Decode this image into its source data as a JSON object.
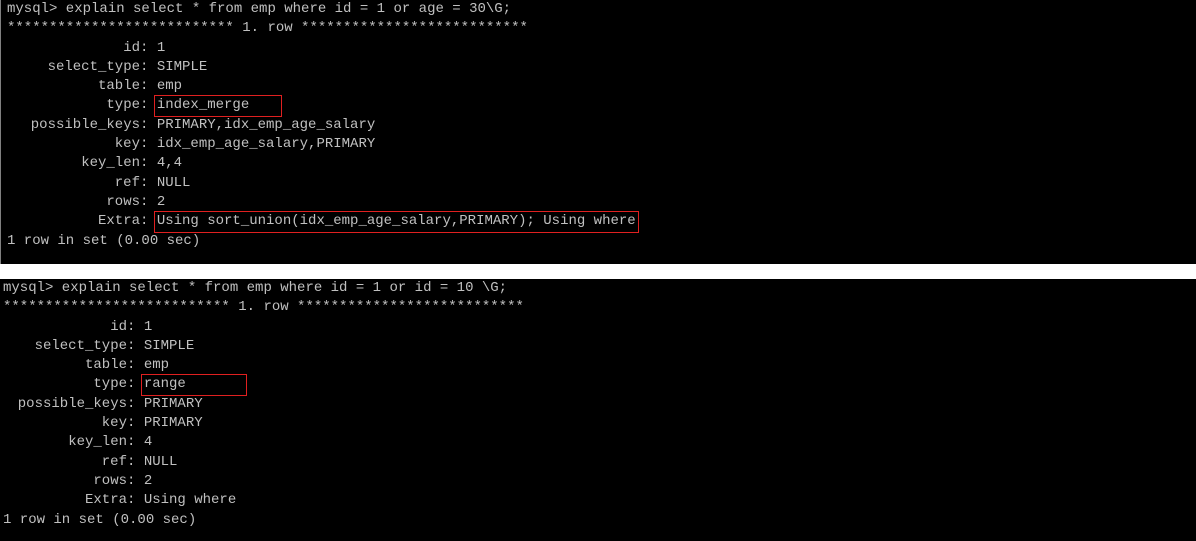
{
  "session_1": {
    "command": "mysql> explain select * from emp where id = 1 or age = 30\\G;",
    "row_header": "*************************** 1. row ***************************",
    "fields": [
      {
        "label": "id",
        "value": "1"
      },
      {
        "label": "select_type",
        "value": "SIMPLE"
      },
      {
        "label": "table",
        "value": "emp"
      },
      {
        "label": "type",
        "value": "index_merge"
      },
      {
        "label": "possible_keys",
        "value": "PRIMARY,idx_emp_age_salary"
      },
      {
        "label": "key",
        "value": "idx_emp_age_salary,PRIMARY"
      },
      {
        "label": "key_len",
        "value": "4,4"
      },
      {
        "label": "ref",
        "value": "NULL"
      },
      {
        "label": "rows",
        "value": "2"
      },
      {
        "label": "Extra",
        "value": "Using sort_union(idx_emp_age_salary,PRIMARY); Using where"
      }
    ],
    "footer": "1 row in set (0.00 sec)"
  },
  "session_2": {
    "command": "mysql> explain select * from emp where id = 1 or id = 10 \\G;",
    "row_header": "*************************** 1. row ***************************",
    "fields": [
      {
        "label": "id",
        "value": "1"
      },
      {
        "label": "select_type",
        "value": "SIMPLE"
      },
      {
        "label": "table",
        "value": "emp"
      },
      {
        "label": "type",
        "value": "range"
      },
      {
        "label": "possible_keys",
        "value": "PRIMARY"
      },
      {
        "label": "key",
        "value": "PRIMARY"
      },
      {
        "label": "key_len",
        "value": "4"
      },
      {
        "label": "ref",
        "value": "NULL"
      },
      {
        "label": "rows",
        "value": "2"
      },
      {
        "label": "Extra",
        "value": "Using where"
      }
    ],
    "footer": "1 row in set (0.00 sec)"
  },
  "colors": {
    "terminal_bg": "#000000",
    "terminal_text": "#c0c0c0",
    "highlight_box": "#e02020"
  }
}
